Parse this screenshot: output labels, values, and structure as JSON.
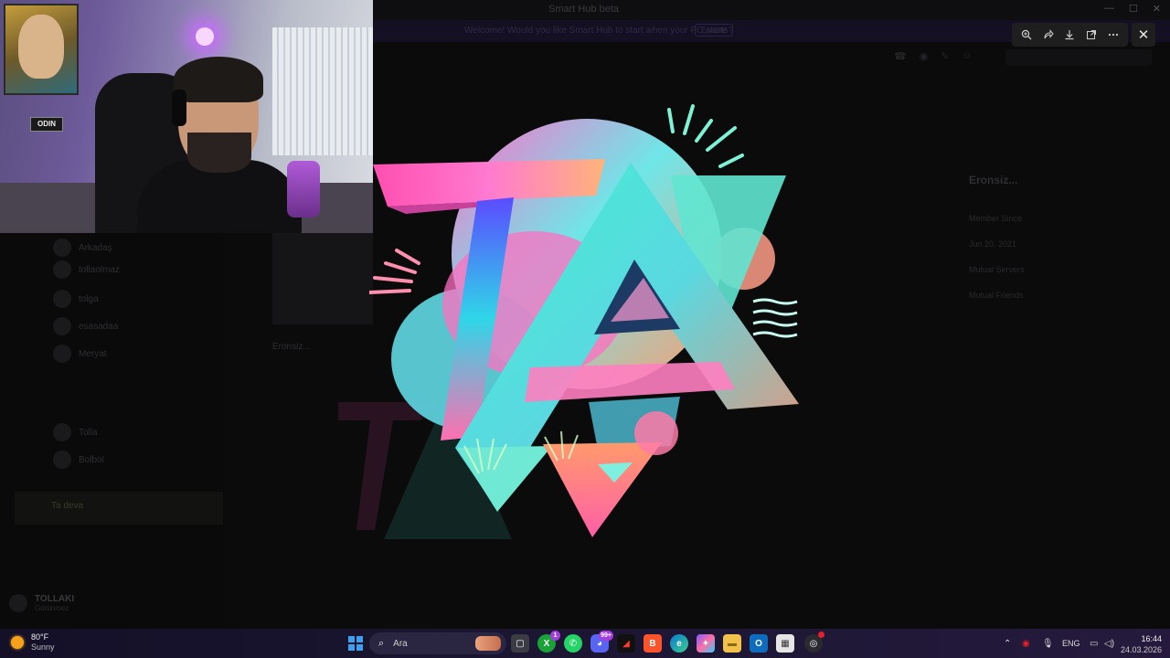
{
  "background_app": {
    "window_title": "Smart Hub beta",
    "notice_text": "Welcome! Would you like Smart Hub to start when your PC starts?",
    "notice_button": "Enable",
    "sidebar_items": [
      {
        "label": "Arkadaş"
      },
      {
        "label": "tollaolmaz"
      },
      {
        "label": "tolga"
      },
      {
        "label": "esasadaa"
      },
      {
        "label": "Meryat"
      },
      {
        "label": "Tolla"
      },
      {
        "label": "Bolbol"
      }
    ],
    "call_label": "Ta deva",
    "user_name": "TOLLAKI",
    "user_status": "Görünmez",
    "ghost_caption": "Eronsiz...",
    "profile_name": "Eronsiz...",
    "profile_rows": [
      "Member Since",
      "Jun 20, 2021",
      "Mutual Servers",
      "Mutual Friends"
    ]
  },
  "webcam": {
    "sign_text": "ODIN"
  },
  "viewer": {
    "toolbar_icons": [
      "zoom-in-icon",
      "forward-icon",
      "download-icon",
      "open-external-icon",
      "more-icon"
    ],
    "close_symbol": "✕"
  },
  "logo": {
    "subject": "TA monogram artwork",
    "colors": [
      "#ff4fb4",
      "#3fe0c8",
      "#7a3cff",
      "#ff9a6b"
    ]
  },
  "taskbar": {
    "weather_temp": "80°F",
    "weather_desc": "Sunny",
    "search_placeholder": "Ara",
    "badges": {
      "xbox": "1",
      "discord": "99+"
    },
    "tray_language": "ENG",
    "clock_time": "16:44",
    "clock_date": "24.03.2026"
  }
}
